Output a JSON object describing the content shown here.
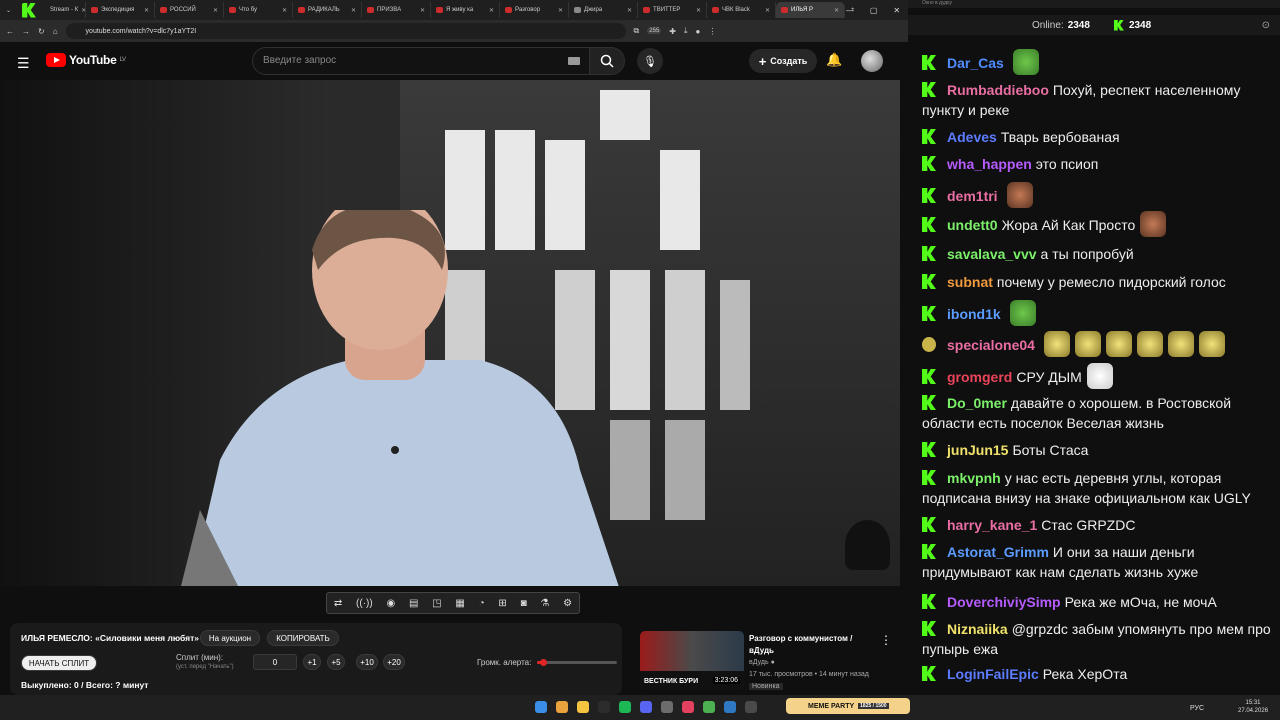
{
  "browser": {
    "tabs": [
      {
        "label": "Stream - К",
        "fav": "kick"
      },
      {
        "label": "Экспедиция",
        "fav": "yt"
      },
      {
        "label": "РОССИЙ",
        "fav": "yt"
      },
      {
        "label": "Что бу",
        "fav": "yt"
      },
      {
        "label": "РАДИКАЛЬ",
        "fav": "yt"
      },
      {
        "label": "ПРИЗВА",
        "fav": "yt"
      },
      {
        "label": "Я живу ка",
        "fav": "yt"
      },
      {
        "label": "Разговор",
        "fav": "yt"
      },
      {
        "label": "Джира",
        "fav": "doc"
      },
      {
        "label": "ТВИТТЕР",
        "fav": "yt"
      },
      {
        "label": "ЧВК Black",
        "fav": "yt"
      },
      {
        "label": "ИЛЬЯ Р",
        "fav": "yt",
        "active": true
      }
    ],
    "url": "youtube.com/watch?v=dlc7y1aYT2I",
    "badge_count": "255"
  },
  "youtube": {
    "logo_text": "YouTube",
    "region": "LV",
    "search_placeholder": "Введите запрос",
    "create_label": "Создать"
  },
  "overlay": {
    "title": "ИЛЬЯ РЕМЕСЛО: «Силовики меня любят»",
    "auction_button": "На аукцион",
    "copy_button": "КОПИРОВАТЬ",
    "start_split": "НАЧАТЬ СПЛИТ",
    "split_label": "Сплит (мин):",
    "split_hint": "(уст. перед \"Начать\")",
    "split_value": "0",
    "increments": [
      "+1",
      "+5",
      "+10",
      "+20"
    ],
    "volume_label": "Громк. алерта:",
    "volume_level": 0.08,
    "bought": "Выкуплено: 0 / Всего: ? минут"
  },
  "recommendation": {
    "title": "Разговор с коммунистом / вДудь",
    "channel": "вДудь",
    "meta": "17 тыс. просмотров • 14 минут назад",
    "badge": "Новинка",
    "duration": "3:23:06",
    "thumb_text": "ВЕСТНИК БУРИ"
  },
  "chat": {
    "window_title": "Окно в дудку",
    "online_label": "Online:",
    "online_count": "2348",
    "kick_count": "2348",
    "messages": [
      {
        "user": "Dar_Cas",
        "color": "#4f8cff",
        "text": "",
        "emotes": [
          "pepe"
        ]
      },
      {
        "user": "Rumbaddieboo",
        "color": "#e96ea3",
        "text": "Похуй, респект населенному пункту и реке",
        "emotes": []
      },
      {
        "user": "Adeves",
        "color": "#5b7cff",
        "text": "Тварь вербованая",
        "emotes": []
      },
      {
        "user": "wha_happen",
        "color": "#b65cff",
        "text": "это псиоп",
        "emotes": []
      },
      {
        "user": "dem1tri",
        "color": "#e96ea3",
        "text": "",
        "emotes": [
          "face"
        ]
      },
      {
        "user": "undett0",
        "color": "#7cf06a",
        "text": "Жора Ай Как Просто",
        "emotes": [
          "face"
        ]
      },
      {
        "user": "savalava_vvv",
        "color": "#7cf06a",
        "text": "а ты попробуй",
        "emotes": []
      },
      {
        "user": "subnat",
        "color": "#f09a3e",
        "text": "почему у ремесло пидорский голос",
        "emotes": []
      },
      {
        "user": "ibond1k",
        "color": "#5b9cff",
        "text": "",
        "emotes": [
          "pepe"
        ]
      },
      {
        "user": "specialone04",
        "color": "#e96ea3",
        "text": "",
        "emotes": [
          "yellow",
          "yellow",
          "yellow",
          "yellow",
          "yellow",
          "yellow"
        ]
      },
      {
        "user": "gromgerd",
        "color": "#e9445a",
        "text": "СРУ ДЫМ",
        "emotes": [
          "white"
        ]
      },
      {
        "user": "Do_0mer",
        "color": "#7cf06a",
        "text": "давайте о хорошем. в Ростовской области есть поселок Веселая жизнь",
        "emotes": []
      },
      {
        "user": "junJun15",
        "color": "#f0e26a",
        "text": "Боты Стаса",
        "emotes": []
      },
      {
        "user": "mkvpnh",
        "color": "#7cf06a",
        "text": "у нас есть деревня углы, которая подписана внизу на знаке официальном как UGLY",
        "emotes": []
      },
      {
        "user": "harry_kane_1",
        "color": "#e96ea3",
        "text": "Стас GRPZDC",
        "emotes": []
      },
      {
        "user": "Astorat_Grimm",
        "color": "#5b9cff",
        "text": "И они за наши деньги придумывают как нам сделать жизнь хуже",
        "emotes": []
      },
      {
        "user": "DoverchiviySimp",
        "color": "#b65cff",
        "text": "Река же мОча, не мочА",
        "emotes": []
      },
      {
        "user": "Niznaiika",
        "color": "#f0e26a",
        "text": "@grpzdc забым упомянуть про мем про пупырь ежа",
        "emotes": []
      },
      {
        "user": "LoginFailEpic",
        "color": "#5b7cff",
        "text": "Река ХерОта",
        "emotes": []
      }
    ]
  },
  "taskbar": {
    "lang": "РУС",
    "time": "15:31",
    "date": "27.04.2026",
    "widget": "MEME PARTY",
    "widget_sub": "1825 / 1500"
  }
}
